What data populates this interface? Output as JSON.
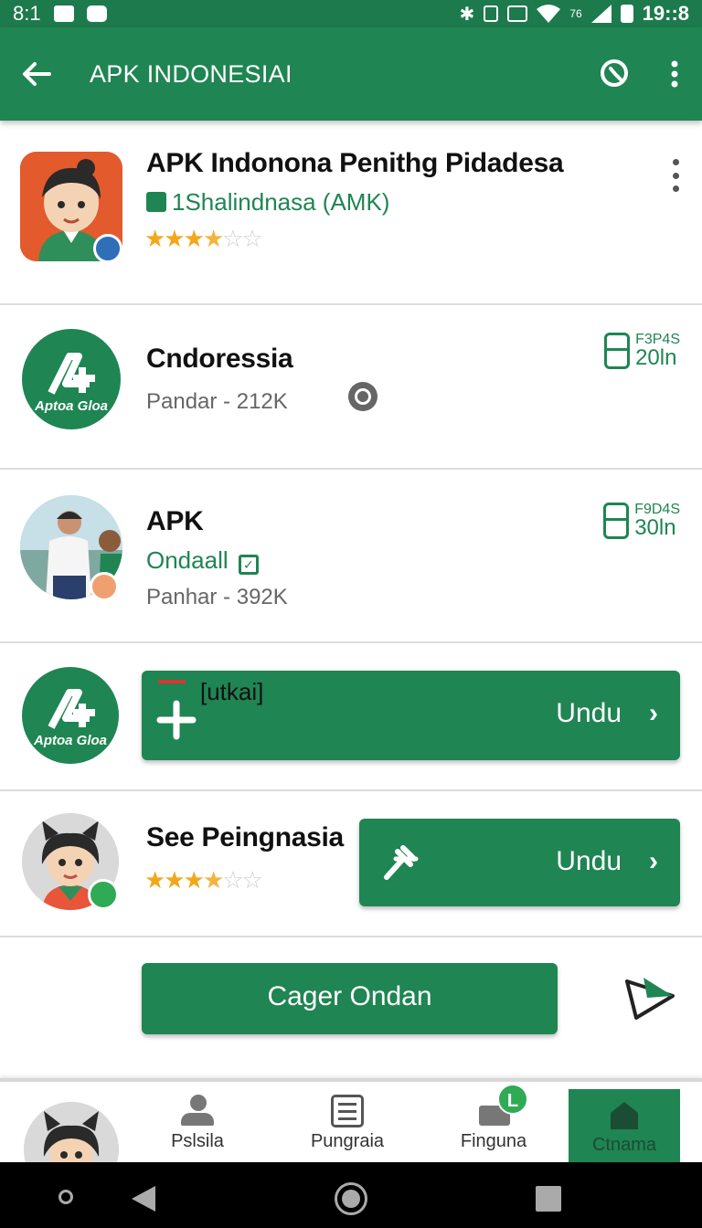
{
  "status_bar": {
    "left_text": "8:1",
    "time": "19::8",
    "signal_text": "76"
  },
  "app_bar": {
    "title": "APK INDONESIAI",
    "icons": [
      "back-arrow-icon",
      "search-icon",
      "more-vert-icon"
    ]
  },
  "items": [
    {
      "title": "APK Indonona Penithg Pidadesa",
      "subtitle": "1Shalindnasa (AMK)",
      "rating": 3.5,
      "max_rating": 5
    },
    {
      "title": "Cndoressia",
      "meta": "Pandar - 212K",
      "icon_text": "Aptoa Gloa",
      "status": {
        "code": "F3P4S",
        "value": "20ln"
      }
    },
    {
      "title": "APK",
      "subtitle": "Ondaall",
      "meta": "Panhar - 392K",
      "status": {
        "code": "F9D4S",
        "value": "30ln"
      }
    },
    {
      "icon_text": "Aptoa Gloa",
      "tag": "[utkai]",
      "button": "Undu"
    },
    {
      "title": "See Peingnasia",
      "rating": 3.5,
      "max_rating": 5,
      "button": "Undu"
    },
    {
      "button": "Cager Ondan"
    }
  ],
  "bottom_nav": [
    {
      "label": "Pslsila",
      "icon": "person-icon"
    },
    {
      "label": "Pungraia",
      "icon": "list-icon"
    },
    {
      "label": "Finguna",
      "icon": "printer-icon",
      "badge": "L"
    },
    {
      "label": "Ctnama",
      "icon": "home-icon",
      "active": true
    }
  ],
  "colors": {
    "primary": "#1f8553",
    "status_bar": "#1d7a4d",
    "star": "#f3a71b"
  }
}
